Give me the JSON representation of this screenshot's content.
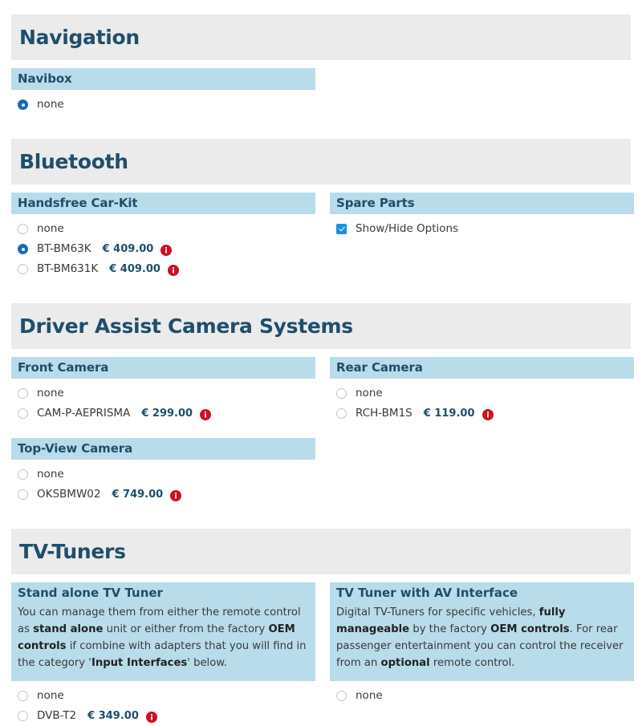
{
  "sections": [
    {
      "title": "Navigation",
      "panels": [
        {
          "heading": "Navibox",
          "options": [
            {
              "label": "none",
              "price": "",
              "selected": true,
              "info": false
            }
          ]
        }
      ]
    },
    {
      "title": "Bluetooth",
      "panels": [
        {
          "heading": "Handsfree Car-Kit",
          "options": [
            {
              "label": "none",
              "price": "",
              "selected": false,
              "info": false
            },
            {
              "label": "BT-BM63K",
              "price": "€ 409.00",
              "selected": true,
              "info": true
            },
            {
              "label": "BT-BM631K",
              "price": "€ 409.00",
              "selected": false,
              "info": true
            }
          ]
        },
        {
          "heading": "Spare Parts",
          "checkbox": {
            "label": "Show/Hide Options",
            "checked": true
          }
        }
      ]
    },
    {
      "title": "Driver Assist Camera Systems",
      "panels": [
        {
          "heading": "Front Camera",
          "options": [
            {
              "label": "none",
              "price": "",
              "selected": false,
              "info": false
            },
            {
              "label": "CAM-P-AEPRISMA",
              "price": "€ 299.00",
              "selected": false,
              "info": true
            }
          ]
        },
        {
          "heading": "Rear Camera",
          "options": [
            {
              "label": "none",
              "price": "",
              "selected": false,
              "info": false
            },
            {
              "label": "RCH-BM1S",
              "price": "€ 119.00",
              "selected": false,
              "info": true
            }
          ]
        },
        {
          "heading": "Top-View Camera",
          "options": [
            {
              "label": "none",
              "price": "",
              "selected": false,
              "info": false
            },
            {
              "label": "OKSBMW02",
              "price": "€ 749.00",
              "selected": false,
              "info": true
            }
          ]
        }
      ]
    },
    {
      "title": "TV-Tuners",
      "panels": [
        {
          "heading": "Stand alone TV Tuner",
          "description_html": "You can manage them from either the remote control as <b>stand alone</b> unit or either from the factory <b>OEM controls</b> if combine with adapters that you will find in the category '<b>Input Interfaces</b>' below.",
          "options": [
            {
              "label": "none",
              "price": "",
              "selected": false,
              "info": false
            },
            {
              "label": "DVB-T2",
              "price": "€ 349.00",
              "selected": false,
              "info": true
            }
          ]
        },
        {
          "heading": "TV Tuner with AV Interface",
          "description_html": "Digital TV-Tuners for specific vehicles, <b>fully manageable</b> by the factory <b>OEM controls</b>. For rear passenger entertainment you can control the receiver from an <b>optional</b> remote control.",
          "options": [
            {
              "label": "none",
              "price": "",
              "selected": false,
              "info": false
            }
          ]
        }
      ]
    }
  ],
  "colors": {
    "section_header_bg": "#ebebeb",
    "panel_header_bg": "#b8dcea",
    "heading_text": "#1f4e6b",
    "price_text": "#1f4e6b",
    "info_icon": "#cc1122",
    "radio_selected": "#1767c8",
    "checkbox_checked": "#1a8fe0"
  },
  "icons": {
    "info": "info-icon"
  }
}
